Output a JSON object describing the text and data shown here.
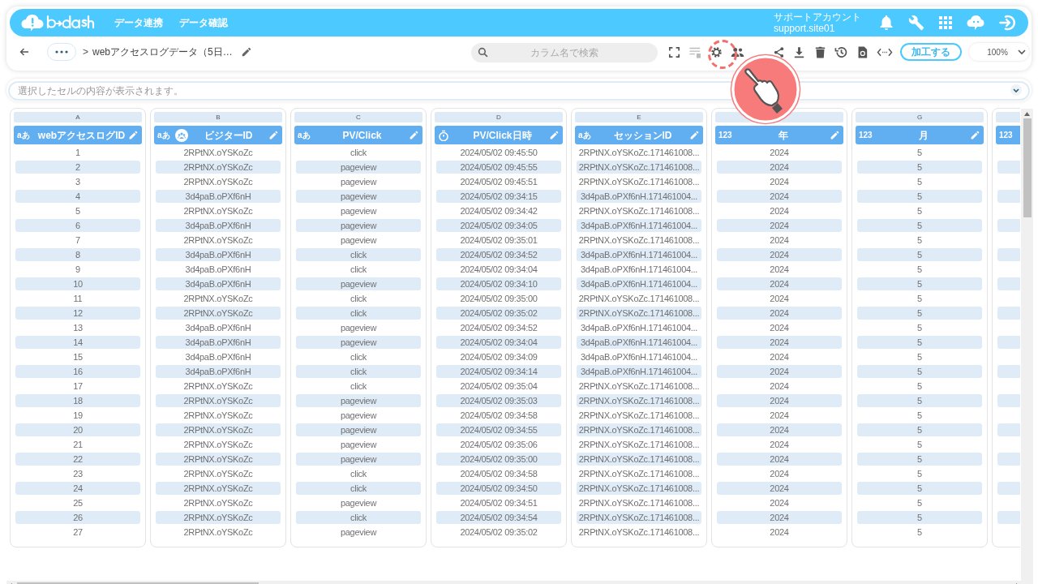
{
  "header": {
    "nav": [
      "データ連携",
      "データ確認"
    ],
    "account": {
      "name": "サポートアカウント",
      "id": "support.site01"
    }
  },
  "toolbar": {
    "separator": ">",
    "title": "webアクセスログデータ（5日…",
    "search": {
      "placeholder": "カラム名で検索"
    },
    "process_button": "加工する",
    "zoom": "100%"
  },
  "cell_viewer": {
    "placeholder": "選択したセルの内容が表示されます。"
  },
  "columns": [
    {
      "letter": "A",
      "name": "webアクセスログID",
      "type_mark": "aあ"
    },
    {
      "letter": "B",
      "name": "ビジターID",
      "type_mark": "aあ",
      "visitor_icon": true
    },
    {
      "letter": "C",
      "name": "PV/Click",
      "type_mark": "aあ"
    },
    {
      "letter": "D",
      "name": "PV/Click日時",
      "kind": "datetime"
    },
    {
      "letter": "E",
      "name": "セッションID",
      "type_mark": "aあ"
    },
    {
      "name": "年",
      "type_mark": "123"
    },
    {
      "letter": "G",
      "name": "月",
      "type_mark": "123"
    },
    {
      "type_mark": "123"
    }
  ],
  "rows": [
    [
      "1",
      "2RPtNX.oYSKoZc",
      "click",
      "2024/05/02 09:45:50",
      "2RPtNX.oYSKoZc.171461008...",
      "2024",
      "5"
    ],
    [
      "2",
      "2RPtNX.oYSKoZc",
      "pageview",
      "2024/05/02 09:45:55",
      "2RPtNX.oYSKoZc.171461008...",
      "2024",
      "5"
    ],
    [
      "3",
      "2RPtNX.oYSKoZc",
      "pageview",
      "2024/05/02 09:45:51",
      "2RPtNX.oYSKoZc.171461008...",
      "2024",
      "5"
    ],
    [
      "4",
      "3d4paB.oPXf6nH",
      "pageview",
      "2024/05/02 09:34:15",
      "3d4paB.oPXf6nH.171461004...",
      "2024",
      "5"
    ],
    [
      "5",
      "2RPtNX.oYSKoZc",
      "pageview",
      "2024/05/02 09:34:42",
      "2RPtNX.oYSKoZc.171461008...",
      "2024",
      "5"
    ],
    [
      "6",
      "3d4paB.oPXf6nH",
      "pageview",
      "2024/05/02 09:34:05",
      "3d4paB.oPXf6nH.171461004...",
      "2024",
      "5"
    ],
    [
      "7",
      "2RPtNX.oYSKoZc",
      "pageview",
      "2024/05/02 09:35:01",
      "2RPtNX.oYSKoZc.171461008...",
      "2024",
      "5"
    ],
    [
      "8",
      "3d4paB.oPXf6nH",
      "click",
      "2024/05/02 09:34:52",
      "3d4paB.oPXf6nH.171461004...",
      "2024",
      "5"
    ],
    [
      "9",
      "3d4paB.oPXf6nH",
      "click",
      "2024/05/02 09:34:04",
      "3d4paB.oPXf6nH.171461004...",
      "2024",
      "5"
    ],
    [
      "10",
      "3d4paB.oPXf6nH",
      "pageview",
      "2024/05/02 09:34:10",
      "3d4paB.oPXf6nH.171461004...",
      "2024",
      "5"
    ],
    [
      "11",
      "2RPtNX.oYSKoZc",
      "click",
      "2024/05/02 09:35:00",
      "2RPtNX.oYSKoZc.171461008...",
      "2024",
      "5"
    ],
    [
      "12",
      "2RPtNX.oYSKoZc",
      "click",
      "2024/05/02 09:35:02",
      "2RPtNX.oYSKoZc.171461008...",
      "2024",
      "5"
    ],
    [
      "13",
      "3d4paB.oPXf6nH",
      "pageview",
      "2024/05/02 09:34:52",
      "3d4paB.oPXf6nH.171461004...",
      "2024",
      "5"
    ],
    [
      "14",
      "3d4paB.oPXf6nH",
      "pageview",
      "2024/05/02 09:34:04",
      "3d4paB.oPXf6nH.171461004...",
      "2024",
      "5"
    ],
    [
      "15",
      "3d4paB.oPXf6nH",
      "click",
      "2024/05/02 09:34:09",
      "3d4paB.oPXf6nH.171461004...",
      "2024",
      "5"
    ],
    [
      "16",
      "3d4paB.oPXf6nH",
      "click",
      "2024/05/02 09:34:14",
      "3d4paB.oPXf6nH.171461004...",
      "2024",
      "5"
    ],
    [
      "17",
      "2RPtNX.oYSKoZc",
      "click",
      "2024/05/02 09:35:04",
      "2RPtNX.oYSKoZc.171461008...",
      "2024",
      "5"
    ],
    [
      "18",
      "2RPtNX.oYSKoZc",
      "pageview",
      "2024/05/02 09:35:03",
      "2RPtNX.oYSKoZc.171461008...",
      "2024",
      "5"
    ],
    [
      "19",
      "2RPtNX.oYSKoZc",
      "pageview",
      "2024/05/02 09:34:58",
      "2RPtNX.oYSKoZc.171461008...",
      "2024",
      "5"
    ],
    [
      "20",
      "2RPtNX.oYSKoZc",
      "pageview",
      "2024/05/02 09:34:55",
      "2RPtNX.oYSKoZc.171461008...",
      "2024",
      "5"
    ],
    [
      "21",
      "2RPtNX.oYSKoZc",
      "pageview",
      "2024/05/02 09:35:06",
      "2RPtNX.oYSKoZc.171461008...",
      "2024",
      "5"
    ],
    [
      "22",
      "2RPtNX.oYSKoZc",
      "pageview",
      "2024/05/02 09:35:00",
      "2RPtNX.oYSKoZc.171461008...",
      "2024",
      "5"
    ],
    [
      "23",
      "2RPtNX.oYSKoZc",
      "click",
      "2024/05/02 09:34:58",
      "2RPtNX.oYSKoZc.171461008...",
      "2024",
      "5"
    ],
    [
      "24",
      "2RPtNX.oYSKoZc",
      "click",
      "2024/05/02 09:34:50",
      "2RPtNX.oYSKoZc.171461008...",
      "2024",
      "5"
    ],
    [
      "25",
      "2RPtNX.oYSKoZc",
      "pageview",
      "2024/05/02 09:34:51",
      "2RPtNX.oYSKoZc.171461008...",
      "2024",
      "5"
    ],
    [
      "26",
      "2RPtNX.oYSKoZc",
      "click",
      "2024/05/02 09:34:54",
      "2RPtNX.oYSKoZc.171461008...",
      "2024",
      "5"
    ],
    [
      "27",
      "2RPtNX.oYSKoZc",
      "pageview",
      "2024/05/02 09:35:02",
      "2RPtNX.oYSKoZc.171461008...",
      "2024",
      "5"
    ]
  ]
}
